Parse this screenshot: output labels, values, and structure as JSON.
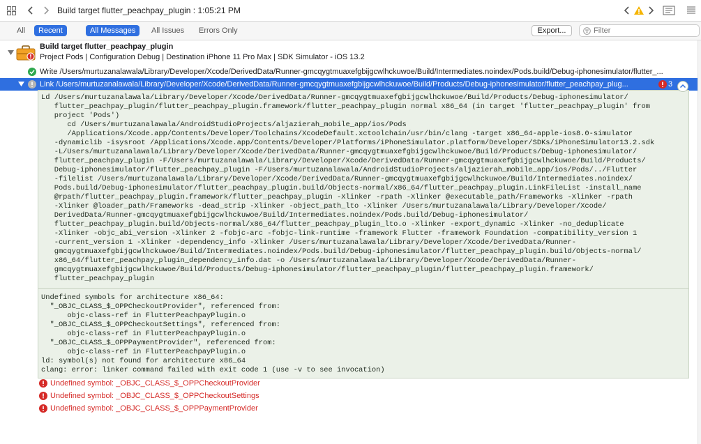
{
  "titlebar": {
    "title": "Build target flutter_peachpay_plugin : 1:05:21 PM"
  },
  "filterbar": {
    "tabs": [
      {
        "label": "All",
        "selected": false
      },
      {
        "label": "Recent",
        "selected": true
      },
      {
        "label": "All Messages",
        "selected": true
      },
      {
        "label": "All Issues",
        "selected": false
      },
      {
        "label": "Errors Only",
        "selected": false
      }
    ],
    "export_label": "Export...",
    "filter_placeholder": "Filter"
  },
  "build": {
    "title": "Build target flutter_peachpay_plugin",
    "subtitle": "Project Pods | Configuration Debug | Destination iPhone 11 Pro Max | SDK Simulator - iOS 13.2",
    "write_step": "Write /Users/murtuzanalawala/Library/Developer/Xcode/DerivedData/Runner-gmcqygtmuaxefgbijgcwlhckuwoe/Build/Intermediates.noindex/Pods.build/Debug-iphonesimulator/flutter_...",
    "link_step": "Link /Users/murtuzanalawala/Library/Developer/Xcode/DerivedData/Runner-gmcqygtmuaxefgbijgcwlhckuwoe/Build/Products/Debug-iphonesimulator/flutter_peachpay_plug...",
    "link_error_count": "3"
  },
  "log": {
    "command": "Ld /Users/murtuzanalawala/Library/Developer/Xcode/DerivedData/Runner-gmcqygtmuaxefgbijgcwlhckuwoe/Build/Products/Debug-iphonesimulator/\n   flutter_peachpay_plugin/flutter_peachpay_plugin.framework/flutter_peachpay_plugin normal x86_64 (in target 'flutter_peachpay_plugin' from\n   project 'Pods')\n      cd /Users/murtuzanalawala/AndroidStudioProjects/aljazierah_mobile_app/ios/Pods\n      /Applications/Xcode.app/Contents/Developer/Toolchains/XcodeDefault.xctoolchain/usr/bin/clang -target x86_64-apple-ios8.0-simulator\n   -dynamiclib -isysroot /Applications/Xcode.app/Contents/Developer/Platforms/iPhoneSimulator.platform/Developer/SDKs/iPhoneSimulator13.2.sdk\n   -L/Users/murtuzanalawala/Library/Developer/Xcode/DerivedData/Runner-gmcqygtmuaxefgbijgcwlhckuwoe/Build/Products/Debug-iphonesimulator/\n   flutter_peachpay_plugin -F/Users/murtuzanalawala/Library/Developer/Xcode/DerivedData/Runner-gmcqygtmuaxefgbijgcwlhckuwoe/Build/Products/\n   Debug-iphonesimulator/flutter_peachpay_plugin -F/Users/murtuzanalawala/AndroidStudioProjects/aljazierah_mobile_app/ios/Pods/../Flutter\n   -filelist /Users/murtuzanalawala/Library/Developer/Xcode/DerivedData/Runner-gmcqygtmuaxefgbijgcwlhckuwoe/Build/Intermediates.noindex/\n   Pods.build/Debug-iphonesimulator/flutter_peachpay_plugin.build/Objects-normal/x86_64/flutter_peachpay_plugin.LinkFileList -install_name\n   @rpath/flutter_peachpay_plugin.framework/flutter_peachpay_plugin -Xlinker -rpath -Xlinker @executable_path/Frameworks -Xlinker -rpath\n   -Xlinker @loader_path/Frameworks -dead_strip -Xlinker -object_path_lto -Xlinker /Users/murtuzanalawala/Library/Developer/Xcode/\n   DerivedData/Runner-gmcqygtmuaxefgbijgcwlhckuwoe/Build/Intermediates.noindex/Pods.build/Debug-iphonesimulator/\n   flutter_peachpay_plugin.build/Objects-normal/x86_64/flutter_peachpay_plugin_lto.o -Xlinker -export_dynamic -Xlinker -no_deduplicate\n   -Xlinker -objc_abi_version -Xlinker 2 -fobjc-arc -fobjc-link-runtime -framework Flutter -framework Foundation -compatibility_version 1\n   -current_version 1 -Xlinker -dependency_info -Xlinker /Users/murtuzanalawala/Library/Developer/Xcode/DerivedData/Runner-\n   gmcqygtmuaxefgbijgcwlhckuwoe/Build/Intermediates.noindex/Pods.build/Debug-iphonesimulator/flutter_peachpay_plugin.build/Objects-normal/\n   x86_64/flutter_peachpay_plugin_dependency_info.dat -o /Users/murtuzanalawala/Library/Developer/Xcode/DerivedData/Runner-\n   gmcqygtmuaxefgbijgcwlhckuwoe/Build/Products/Debug-iphonesimulator/flutter_peachpay_plugin/flutter_peachpay_plugin.framework/\n   flutter_peachpay_plugin",
    "output": "Undefined symbols for architecture x86_64:\n  \"_OBJC_CLASS_$_OPPCheckoutProvider\", referenced from:\n      objc-class-ref in FlutterPeachpayPlugin.o\n  \"_OBJC_CLASS_$_OPPCheckoutSettings\", referenced from:\n      objc-class-ref in FlutterPeachpayPlugin.o\n  \"_OBJC_CLASS_$_OPPPaymentProvider\", referenced from:\n      objc-class-ref in FlutterPeachpayPlugin.o\nld: symbol(s) not found for architecture x86_64\nclang: error: linker command failed with exit code 1 (use -v to see invocation)"
  },
  "issues": [
    {
      "text": "Undefined symbol: _OBJC_CLASS_$_OPPCheckoutProvider"
    },
    {
      "text": "Undefined symbol: _OBJC_CLASS_$_OPPCheckoutSettings"
    },
    {
      "text": "Undefined symbol: _OBJC_CLASS_$_OPPPaymentProvider"
    }
  ],
  "colors": {
    "accent": "#2f6fe0",
    "error": "#d52a27",
    "success": "#2fa84f",
    "warning": "#f5b400",
    "log_bg": "#ebf1e8"
  },
  "icons": {
    "app_grid": "related-items-grid-icon",
    "back": "chevron-left-icon",
    "forward": "chevron-right-icon",
    "warning": "warning-triangle-icon",
    "editor": "editor-lines-icon",
    "build": "toolbox-icon",
    "filter": "filter-icon"
  }
}
